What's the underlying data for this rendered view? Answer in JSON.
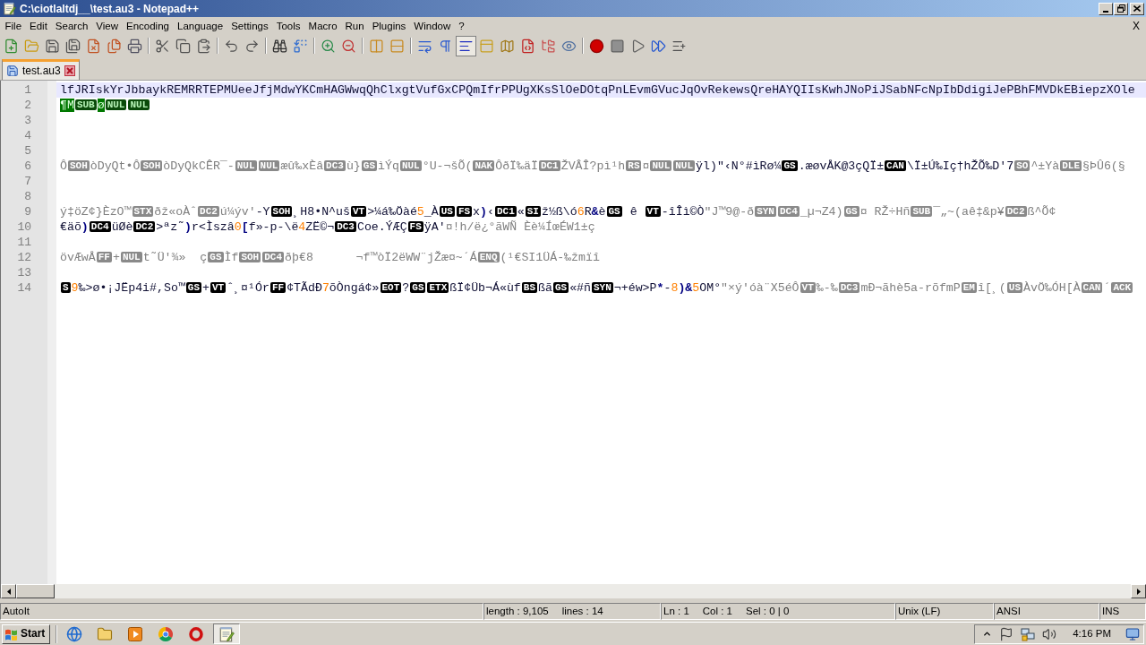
{
  "window": {
    "title": "C:\\ciotlaltdj__\\test.au3 - Notepad++"
  },
  "menu": {
    "items": [
      "File",
      "Edit",
      "Search",
      "View",
      "Encoding",
      "Language",
      "Settings",
      "Tools",
      "Macro",
      "Run",
      "Plugins",
      "Window",
      "?"
    ],
    "close": "X"
  },
  "toolbar": [
    [
      {
        "kind": "new",
        "on": false
      },
      {
        "kind": "open",
        "on": false
      },
      {
        "kind": "save",
        "on": false
      },
      {
        "kind": "save-all",
        "on": false
      },
      {
        "kind": "close",
        "on": false
      },
      {
        "kind": "close-all",
        "on": false
      },
      {
        "kind": "print",
        "on": false
      }
    ],
    [
      {
        "kind": "cut",
        "on": false
      },
      {
        "kind": "copy",
        "on": false
      },
      {
        "kind": "paste",
        "on": false
      }
    ],
    [
      {
        "kind": "undo",
        "on": false
      },
      {
        "kind": "redo",
        "on": false
      }
    ],
    [
      {
        "kind": "find",
        "on": false
      },
      {
        "kind": "replace",
        "on": false
      }
    ],
    [
      {
        "kind": "zoom-in",
        "on": false
      },
      {
        "kind": "zoom-out",
        "on": false
      }
    ],
    [
      {
        "kind": "sync-v",
        "on": false
      },
      {
        "kind": "sync-h",
        "on": false
      }
    ],
    [
      {
        "kind": "wrap",
        "on": false
      },
      {
        "kind": "all-chars",
        "on": false
      },
      {
        "kind": "indent-guide",
        "on": true
      },
      {
        "kind": "udl",
        "on": false
      },
      {
        "kind": "doc-map",
        "on": false
      },
      {
        "kind": "function-list",
        "on": false
      },
      {
        "kind": "workspace",
        "on": false
      },
      {
        "kind": "monitor",
        "on": false
      }
    ],
    [
      {
        "kind": "record",
        "on": false
      },
      {
        "kind": "stop",
        "on": false
      },
      {
        "kind": "play",
        "on": false
      },
      {
        "kind": "play-multi",
        "on": false
      },
      {
        "kind": "save-macro",
        "on": false
      }
    ]
  ],
  "tabs": [
    {
      "label": "test.au3",
      "selected": true
    }
  ],
  "editor": {
    "lines": [
      {
        "number": "1",
        "current": true,
        "segments": [
          {
            "kind": "plain",
            "text": "lfJRIskYrJbbaykREMRRTEPMUeeJfjMdwYKCmHAGWwqQhClxgtVufGxCPQmIfrPPUgXKsSlOeDOtqPnLEvmGVucJqOvRekewsQreHAYQIIsKwhJNoPiJSabNFcNpIbDdigiJePBhFMVDkEBiepzXOle"
          }
        ]
      },
      {
        "number": "2",
        "current": false,
        "segments": [
          {
            "kind": "mark",
            "text": "¶M"
          },
          {
            "kind": "markbadge",
            "text": "SUB"
          },
          {
            "kind": "mark",
            "text": "ø"
          },
          {
            "kind": "markbadge",
            "text": "NUL"
          },
          {
            "kind": "markbadge",
            "text": "NUL"
          }
        ]
      },
      {
        "number": "3",
        "current": false
      },
      {
        "number": "4",
        "current": false
      },
      {
        "number": "5",
        "current": false
      },
      {
        "number": "6",
        "current": false,
        "segments": [
          {
            "kind": "string",
            "text": "Ô"
          },
          {
            "kind": "badge",
            "text": "SOH"
          },
          {
            "kind": "string",
            "text": "òDyQt•Ô"
          },
          {
            "kind": "badge",
            "text": "SOH"
          },
          {
            "kind": "string",
            "text": "òDyQkCÊR¯-"
          },
          {
            "kind": "badge",
            "text": "NUL"
          },
          {
            "kind": "badge",
            "text": "NUL"
          },
          {
            "kind": "string",
            "text": "æû‰xÈâ"
          },
          {
            "kind": "badge",
            "text": "DC3"
          },
          {
            "kind": "string",
            "text": "ù}"
          },
          {
            "kind": "badge",
            "text": "GS"
          },
          {
            "kind": "string",
            "text": "ìÝq"
          },
          {
            "kind": "badge",
            "text": "NUL"
          },
          {
            "kind": "string",
            "text": "°U-¬šÕ("
          },
          {
            "kind": "badge",
            "text": "NAK"
          },
          {
            "kind": "string",
            "text": "ÔðÏ‰äÏ"
          },
          {
            "kind": "badge",
            "text": "DC1"
          },
          {
            "kind": "string",
            "text": "ŽVÂÎ?pì¹h"
          },
          {
            "kind": "badge",
            "text": "RS"
          },
          {
            "kind": "string",
            "text": "¤"
          },
          {
            "kind": "badge",
            "text": "NUL"
          },
          {
            "kind": "badge",
            "text": "NUL"
          },
          {
            "kind": "plain",
            "text": "ÿl)\"‹N°#ìRø¼"
          },
          {
            "kind": "inverse",
            "text": "GS"
          },
          {
            "kind": "plain",
            "text": ".æøvÅK@3çQÏ±"
          },
          {
            "kind": "inverse",
            "text": "CAN"
          },
          {
            "kind": "plain",
            "text": "\\Ï±Ú‰Iç†hŽÕ‰D'7"
          },
          {
            "kind": "badge",
            "text": "SO"
          },
          {
            "kind": "string",
            "text": "^±Yà"
          },
          {
            "kind": "badge",
            "text": "DLE"
          },
          {
            "kind": "string",
            "text": "§ÞÛ6(§"
          }
        ]
      },
      {
        "number": "7",
        "current": false
      },
      {
        "number": "8",
        "current": false
      },
      {
        "number": "9",
        "current": false,
        "segments": [
          {
            "kind": "string",
            "text": "ý‡öZ¢}ÈzO™"
          },
          {
            "kind": "badge",
            "text": "STX"
          },
          {
            "kind": "string",
            "text": "ðž«oÀˆ"
          },
          {
            "kind": "badge",
            "text": "DC2"
          },
          {
            "kind": "string",
            "text": "ú¼ýv'"
          },
          {
            "kind": "plain",
            "text": "-Y"
          },
          {
            "kind": "inverse",
            "text": "SOH"
          },
          {
            "kind": "plain",
            "text": "¸H8•N^uš"
          },
          {
            "kind": "inverse",
            "text": "VT"
          },
          {
            "kind": "plain",
            "text": ">¼á‰Öàé"
          },
          {
            "kind": "number",
            "text": "5"
          },
          {
            "kind": "plain",
            "text": "_À"
          },
          {
            "kind": "inverse",
            "text": "US"
          },
          {
            "kind": "inverse",
            "text": "FS"
          },
          {
            "kind": "plain",
            "text": "x"
          },
          {
            "kind": "operator",
            "text": ")"
          },
          {
            "kind": "plain",
            "text": "‹"
          },
          {
            "kind": "inverse",
            "text": "DC1"
          },
          {
            "kind": "plain",
            "text": "«"
          },
          {
            "kind": "inverse",
            "text": "SI"
          },
          {
            "kind": "plain",
            "text": "ž½ß\\ó"
          },
          {
            "kind": "number",
            "text": "6"
          },
          {
            "kind": "plain",
            "text": "R"
          },
          {
            "kind": "operator",
            "text": "&"
          },
          {
            "kind": "plain",
            "text": "è"
          },
          {
            "kind": "inverse",
            "text": "GS"
          },
          {
            "kind": "plain",
            "text": " ê "
          },
          {
            "kind": "inverse",
            "text": "VT"
          },
          {
            "kind": "plain",
            "text": "-îÎì©Ò"
          },
          {
            "kind": "string",
            "text": "\"J™9@-ð"
          },
          {
            "kind": "badge",
            "text": "SYN"
          },
          {
            "kind": "badge",
            "text": "DC4"
          },
          {
            "kind": "string",
            "text": "_µ¬Z4)"
          },
          {
            "kind": "badge",
            "text": "GS"
          },
          {
            "kind": "string",
            "text": "¤ RŽ÷Hñ"
          },
          {
            "kind": "badge",
            "text": "SUB"
          },
          {
            "kind": "string",
            "text": "¯„~(aê‡&p¥"
          },
          {
            "kind": "badge",
            "text": "DC2"
          },
          {
            "kind": "string",
            "text": "ß^Õ¢"
          }
        ]
      },
      {
        "number": "10",
        "current": false,
        "segments": [
          {
            "kind": "plain",
            "text": "€äõ"
          },
          {
            "kind": "operator",
            "text": ")"
          },
          {
            "kind": "inverse",
            "text": "DC4"
          },
          {
            "kind": "plain",
            "text": "üØè"
          },
          {
            "kind": "inverse",
            "text": "DC2"
          },
          {
            "kind": "plain",
            "text": ">ªz˜"
          },
          {
            "kind": "operator",
            "text": ")"
          },
          {
            "kind": "plain",
            "text": "r<Ìszâ"
          },
          {
            "kind": "number",
            "text": "0"
          },
          {
            "kind": "operator",
            "text": "["
          },
          {
            "kind": "plain",
            "text": "f»-p-\\ë"
          },
          {
            "kind": "number",
            "text": "4"
          },
          {
            "kind": "plain",
            "text": "ZË©¬"
          },
          {
            "kind": "inverse",
            "text": "DC3"
          },
          {
            "kind": "plain",
            "text": "Coe.ÝÆÇ"
          },
          {
            "kind": "inverse",
            "text": "FS"
          },
          {
            "kind": "plain",
            "text": "ÿA'"
          },
          {
            "kind": "string",
            "text": "¤!h/ë¿°ãWÑ Èè¼ÍœÉW1±ç"
          }
        ]
      },
      {
        "number": "11",
        "current": false
      },
      {
        "number": "12",
        "current": false,
        "segments": [
          {
            "kind": "string",
            "text": "övÆwÅ"
          },
          {
            "kind": "badge",
            "text": "FF"
          },
          {
            "kind": "string",
            "text": "+"
          },
          {
            "kind": "badge",
            "text": "NUL"
          },
          {
            "kind": "string",
            "text": "t˜Ü'¾»  ç"
          },
          {
            "kind": "badge",
            "text": "GS"
          },
          {
            "kind": "string",
            "text": "Ìf"
          },
          {
            "kind": "badge",
            "text": "SOH"
          },
          {
            "kind": "badge",
            "text": "DC4"
          },
          {
            "kind": "string",
            "text": "ðþ€8      ¬f™òÏ2ëWW¨jŽæ¤~´Á"
          },
          {
            "kind": "badge",
            "text": "ENQ"
          },
          {
            "kind": "string",
            "text": "(¹€SI1ÜÁ-‰žmïî"
          }
        ]
      },
      {
        "number": "13",
        "current": false
      },
      {
        "number": "14",
        "current": false,
        "segments": [
          {
            "kind": "inverse",
            "text": "S"
          },
          {
            "kind": "number",
            "text": "9"
          },
          {
            "kind": "plain",
            "text": "‰>ø•¡JËp4i#,So™"
          },
          {
            "kind": "inverse",
            "text": "GS"
          },
          {
            "kind": "plain",
            "text": "+"
          },
          {
            "kind": "inverse",
            "text": "VT"
          },
          {
            "kind": "plain",
            "text": "ˆ¸¤¹Ór"
          },
          {
            "kind": "inverse",
            "text": "FF"
          },
          {
            "kind": "plain",
            "text": "¢TÃdÐ"
          },
          {
            "kind": "number",
            "text": "7"
          },
          {
            "kind": "plain",
            "text": "õÒngá¢»"
          },
          {
            "kind": "inverse",
            "text": "EOT"
          },
          {
            "kind": "plain",
            "text": "?"
          },
          {
            "kind": "inverse",
            "text": "GS"
          },
          {
            "kind": "inverse",
            "text": "ETX"
          },
          {
            "kind": "plain",
            "text": "ßÏ¢Üb¬Á«ùf"
          },
          {
            "kind": "inverse",
            "text": "BS"
          },
          {
            "kind": "plain",
            "text": "ßã"
          },
          {
            "kind": "inverse",
            "text": "GS"
          },
          {
            "kind": "plain",
            "text": "«#ñ"
          },
          {
            "kind": "inverse",
            "text": "SYN"
          },
          {
            "kind": "plain",
            "text": "¬+éw>P"
          },
          {
            "kind": "operator",
            "text": "*"
          },
          {
            "kind": "plain",
            "text": "-"
          },
          {
            "kind": "number",
            "text": "8"
          },
          {
            "kind": "operator",
            "text": ")&"
          },
          {
            "kind": "number",
            "text": "5"
          },
          {
            "kind": "plain",
            "text": "OM°"
          },
          {
            "kind": "string",
            "text": "\"×ý'óà¨X5éÔ"
          },
          {
            "kind": "badge",
            "text": "VT"
          },
          {
            "kind": "string",
            "text": "‰-‰"
          },
          {
            "kind": "badge",
            "text": "DC3"
          },
          {
            "kind": "string",
            "text": "mÐ¬ãhè5a-rõfmP"
          },
          {
            "kind": "badge",
            "text": "EM"
          },
          {
            "kind": "string",
            "text": "î[¸("
          },
          {
            "kind": "badge",
            "text": "US"
          },
          {
            "kind": "string",
            "text": "ÀvÖ‰ÓH[À"
          },
          {
            "kind": "badge",
            "text": "CAN"
          },
          {
            "kind": "string",
            "text": "´"
          },
          {
            "kind": "badge",
            "text": "ACK"
          }
        ]
      }
    ]
  },
  "status_bar": [
    {
      "texts": [
        "AutoIt"
      ]
    },
    {
      "texts": [
        "length : 9,105",
        "lines : 14"
      ]
    },
    {
      "texts": [
        "Ln : 1",
        "Col : 1",
        "Sel : 0 | 0"
      ]
    },
    {
      "texts": [
        "Unix (LF)"
      ]
    },
    {
      "texts": [
        "ANSI"
      ]
    },
    {
      "texts": [
        "INS"
      ]
    }
  ],
  "taskbar": {
    "start": "Start",
    "apps": [
      {
        "kind": "globe",
        "selected": false
      },
      {
        "kind": "folder",
        "selected": false
      },
      {
        "kind": "media",
        "selected": false
      },
      {
        "kind": "ball",
        "selected": false
      },
      {
        "kind": "ring",
        "selected": false
      },
      {
        "kind": "notepad",
        "selected": true
      }
    ],
    "clock": "4:16 PM"
  }
}
